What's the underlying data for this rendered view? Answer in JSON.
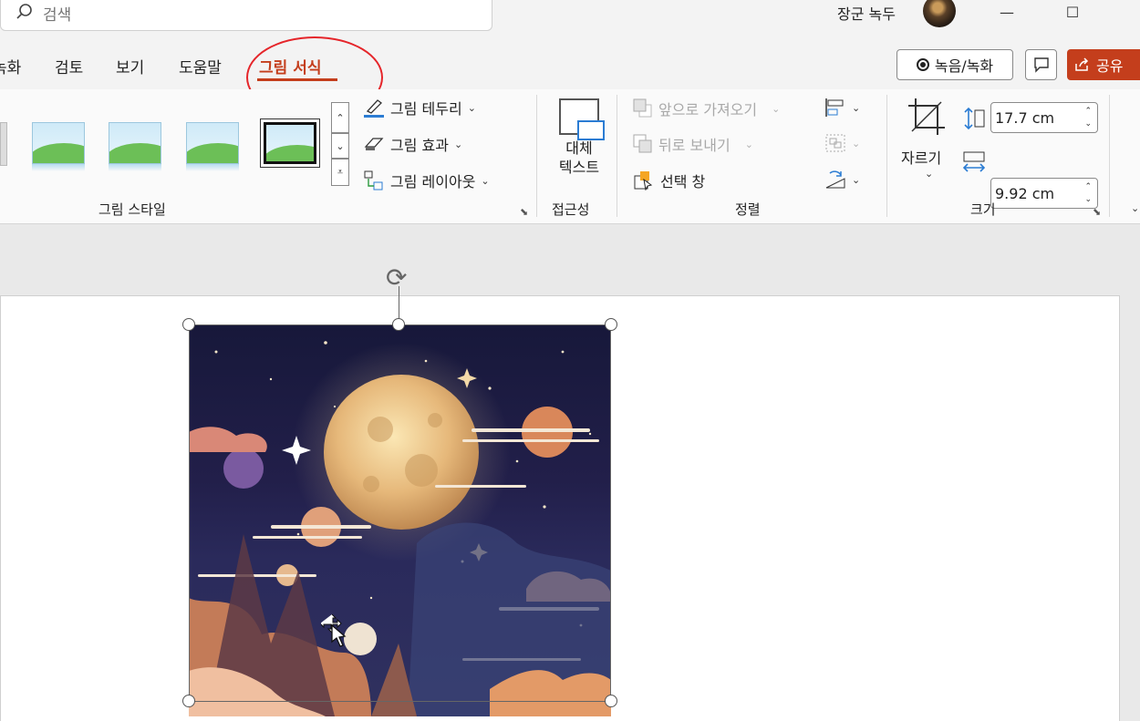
{
  "titlebar": {
    "search_placeholder": "검색",
    "user_name": "장군 녹두",
    "minimize": "—",
    "maximize": "☐"
  },
  "tabs": [
    {
      "label": "녹화",
      "active": false
    },
    {
      "label": "검토",
      "active": false
    },
    {
      "label": "보기",
      "active": false
    },
    {
      "label": "도움말",
      "active": false
    },
    {
      "label": "그림 서식",
      "active": true
    }
  ],
  "header_buttons": {
    "record": "녹음/녹화",
    "share": "공유"
  },
  "ribbon": {
    "picture_styles": {
      "label": "그림 스타일",
      "border": "그림 테두리",
      "effects": "그림 효과",
      "layout": "그림 레이아웃"
    },
    "accessibility": {
      "label": "접근성",
      "alt_text_line1": "대체",
      "alt_text_line2": "텍스트"
    },
    "arrange": {
      "label": "정렬",
      "bring_forward": "앞으로 가져오기",
      "send_backward": "뒤로 보내기",
      "selection_pane": "선택 창"
    },
    "size": {
      "label": "크기",
      "crop": "자르기",
      "height": "17.7 cm",
      "width": "9.92 cm"
    }
  },
  "colors": {
    "accent": "#c43e1c",
    "annotation": "#e5252a"
  }
}
